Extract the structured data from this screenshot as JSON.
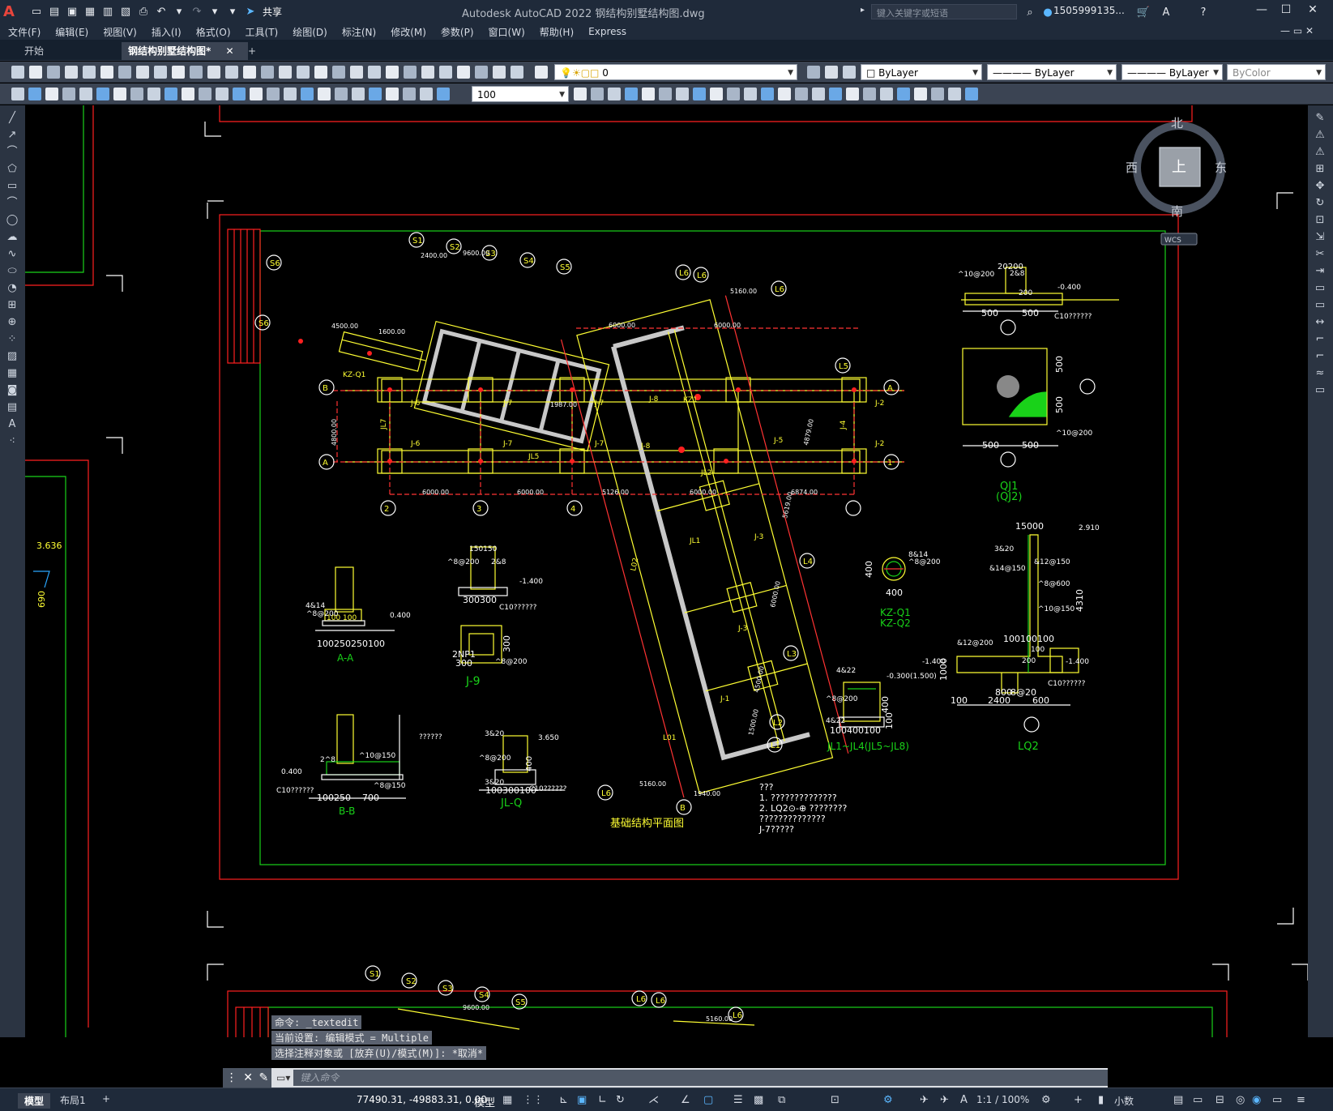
{
  "app": {
    "logo": "A",
    "share_label": "共享",
    "window_title": "Autodesk AutoCAD 2022    钢结构别墅结构图.dwg",
    "search_placeholder": "键入关键字或短语",
    "user": "1505999135...",
    "win_min": "—",
    "win_max": "☐",
    "win_close": "✕"
  },
  "menu": [
    "文件(F)",
    "编辑(E)",
    "视图(V)",
    "插入(I)",
    "格式(O)",
    "工具(T)",
    "绘图(D)",
    "标注(N)",
    "修改(M)",
    "参数(P)",
    "窗口(W)",
    "帮助(H)",
    "Express"
  ],
  "tabs": {
    "start": "开始",
    "doc": "钢结构别墅结构图*",
    "doc_close": "✕",
    "add": "+"
  },
  "toolbar": {
    "layer": "0",
    "color": "ByLayer",
    "linetype": "ByLayer",
    "lineweight": "ByLayer",
    "plotstyle": "ByColor",
    "scale": "100"
  },
  "viewcube": {
    "top": "上",
    "north": "北",
    "south": "南",
    "east": "东",
    "west": "西",
    "wcs": "WCS"
  },
  "drawing": {
    "main_title": "基础结构平面图",
    "axes_circles": [
      "S1",
      "S2",
      "S3",
      "S4",
      "S5",
      "S6",
      "S6",
      "L6",
      "L6",
      "L6",
      "L5",
      "L4",
      "L3",
      "L2",
      "L1",
      "L6",
      "B",
      "B",
      "A",
      "A",
      "1",
      "2",
      "3",
      "4"
    ],
    "dims": [
      "6000.00",
      "6000.00",
      "5126.00",
      "6000.00",
      "6874.00",
      "6000.00",
      "6000.00",
      "5160.00",
      "2400.00",
      "9600.00",
      "4500.00",
      "1600.00",
      "1987.00",
      "4800.00",
      "4879.00",
      "5619.00",
      "6000.00",
      "4500.00",
      "1940.00",
      "1500.00",
      "5160.00"
    ],
    "labels": [
      "J-6",
      "J-7",
      "J-7",
      "J-8",
      "J-2",
      "J-6",
      "J-7",
      "J-7",
      "J-8",
      "J-5",
      "J-2",
      "J-4",
      "J-3",
      "J-3",
      "J-1",
      "JL5",
      "JL2",
      "JL1",
      "L01",
      "L02",
      "KZ1",
      "KZ-Q1",
      "JL7"
    ],
    "details": [
      {
        "title": "A-A",
        "labels": [
          "4&14",
          "^8@200",
          "0.400",
          "100",
          "100",
          "100250250100"
        ]
      },
      {
        "title": "B-B",
        "labels": [
          "2^8",
          "^10@150",
          "0.400",
          "C10??????",
          "^8@150",
          "100250",
          "700",
          "??????"
        ]
      },
      {
        "title": "J-9",
        "labels": [
          "^8@200",
          "2&8",
          "150150",
          "-1.400",
          "300300",
          "C10??????",
          "^8@200",
          "300",
          "300",
          "2NP1"
        ]
      },
      {
        "title": "JL-Q",
        "labels": [
          "3&20",
          "^8@200",
          "3.650",
          "400",
          "3&20",
          "100300100",
          "C10??????"
        ]
      },
      {
        "title": "QJ1\n(QJ2)",
        "labels": [
          "^10@200",
          "2&8",
          "20200",
          "-0.400",
          "200",
          "500",
          "500",
          "C10??????",
          "500",
          "500",
          "^10@200",
          "500",
          "500"
        ]
      },
      {
        "title": "KZ-Q1\nKZ-Q2",
        "labels": [
          "8&14",
          "^8@200",
          "400",
          "400"
        ]
      },
      {
        "title": "JL1~JL4(JL5~JL8)",
        "labels": [
          "4&22",
          "-0.300(1.500)",
          "^8@200",
          "4&22",
          "400",
          "100",
          "100400100"
        ]
      },
      {
        "title": "LQ2",
        "labels": [
          "15000",
          "2.910",
          "3&20",
          "&12@150",
          "&14@150",
          "^8@600",
          "^10@150",
          "4310",
          "-1.400",
          "100100100",
          "&12@200",
          "-1.400",
          "1000",
          "2400",
          "600",
          "200",
          "100",
          "800",
          "8@20",
          "C10??????"
        ]
      }
    ],
    "notes": [
      "???",
      "1. ??????????????",
      "2. LQ2⊙-⊕    ????????",
      "   ??????????????",
      "   J-7?????"
    ],
    "side_labels": [
      "3.636",
      "690"
    ],
    "bottom_view_labels": [
      "S1",
      "S2",
      "S3",
      "S4",
      "S5",
      "L6",
      "L6",
      "L6",
      "9600.00",
      "5160.00"
    ]
  },
  "command_history": [
    "命令: _textedit",
    "当前设置: 编辑模式 = Multiple",
    "选择注释对象或 [放弃(U)/模式(M)]: *取消*"
  ],
  "command_placeholder": "键入命令",
  "status": {
    "model_tab": "模型",
    "layout_tab": "布局1",
    "add_tab": "+",
    "coords": "77490.31, -49883.31, 0.00",
    "model_label": "模型",
    "scale": "1:1 / 100%",
    "units": "小数"
  },
  "colors": {
    "titlebar": "#1f2a3a",
    "toolbar": "#3b4453",
    "drawing_bg": "#000000",
    "border_red": "#ff2020",
    "border_green": "#19d219",
    "struct_yellow": "#ffff33",
    "dim_red": "#ff3333",
    "gray_wall": "#c8c8c8",
    "axis_white": "#ffffff"
  }
}
